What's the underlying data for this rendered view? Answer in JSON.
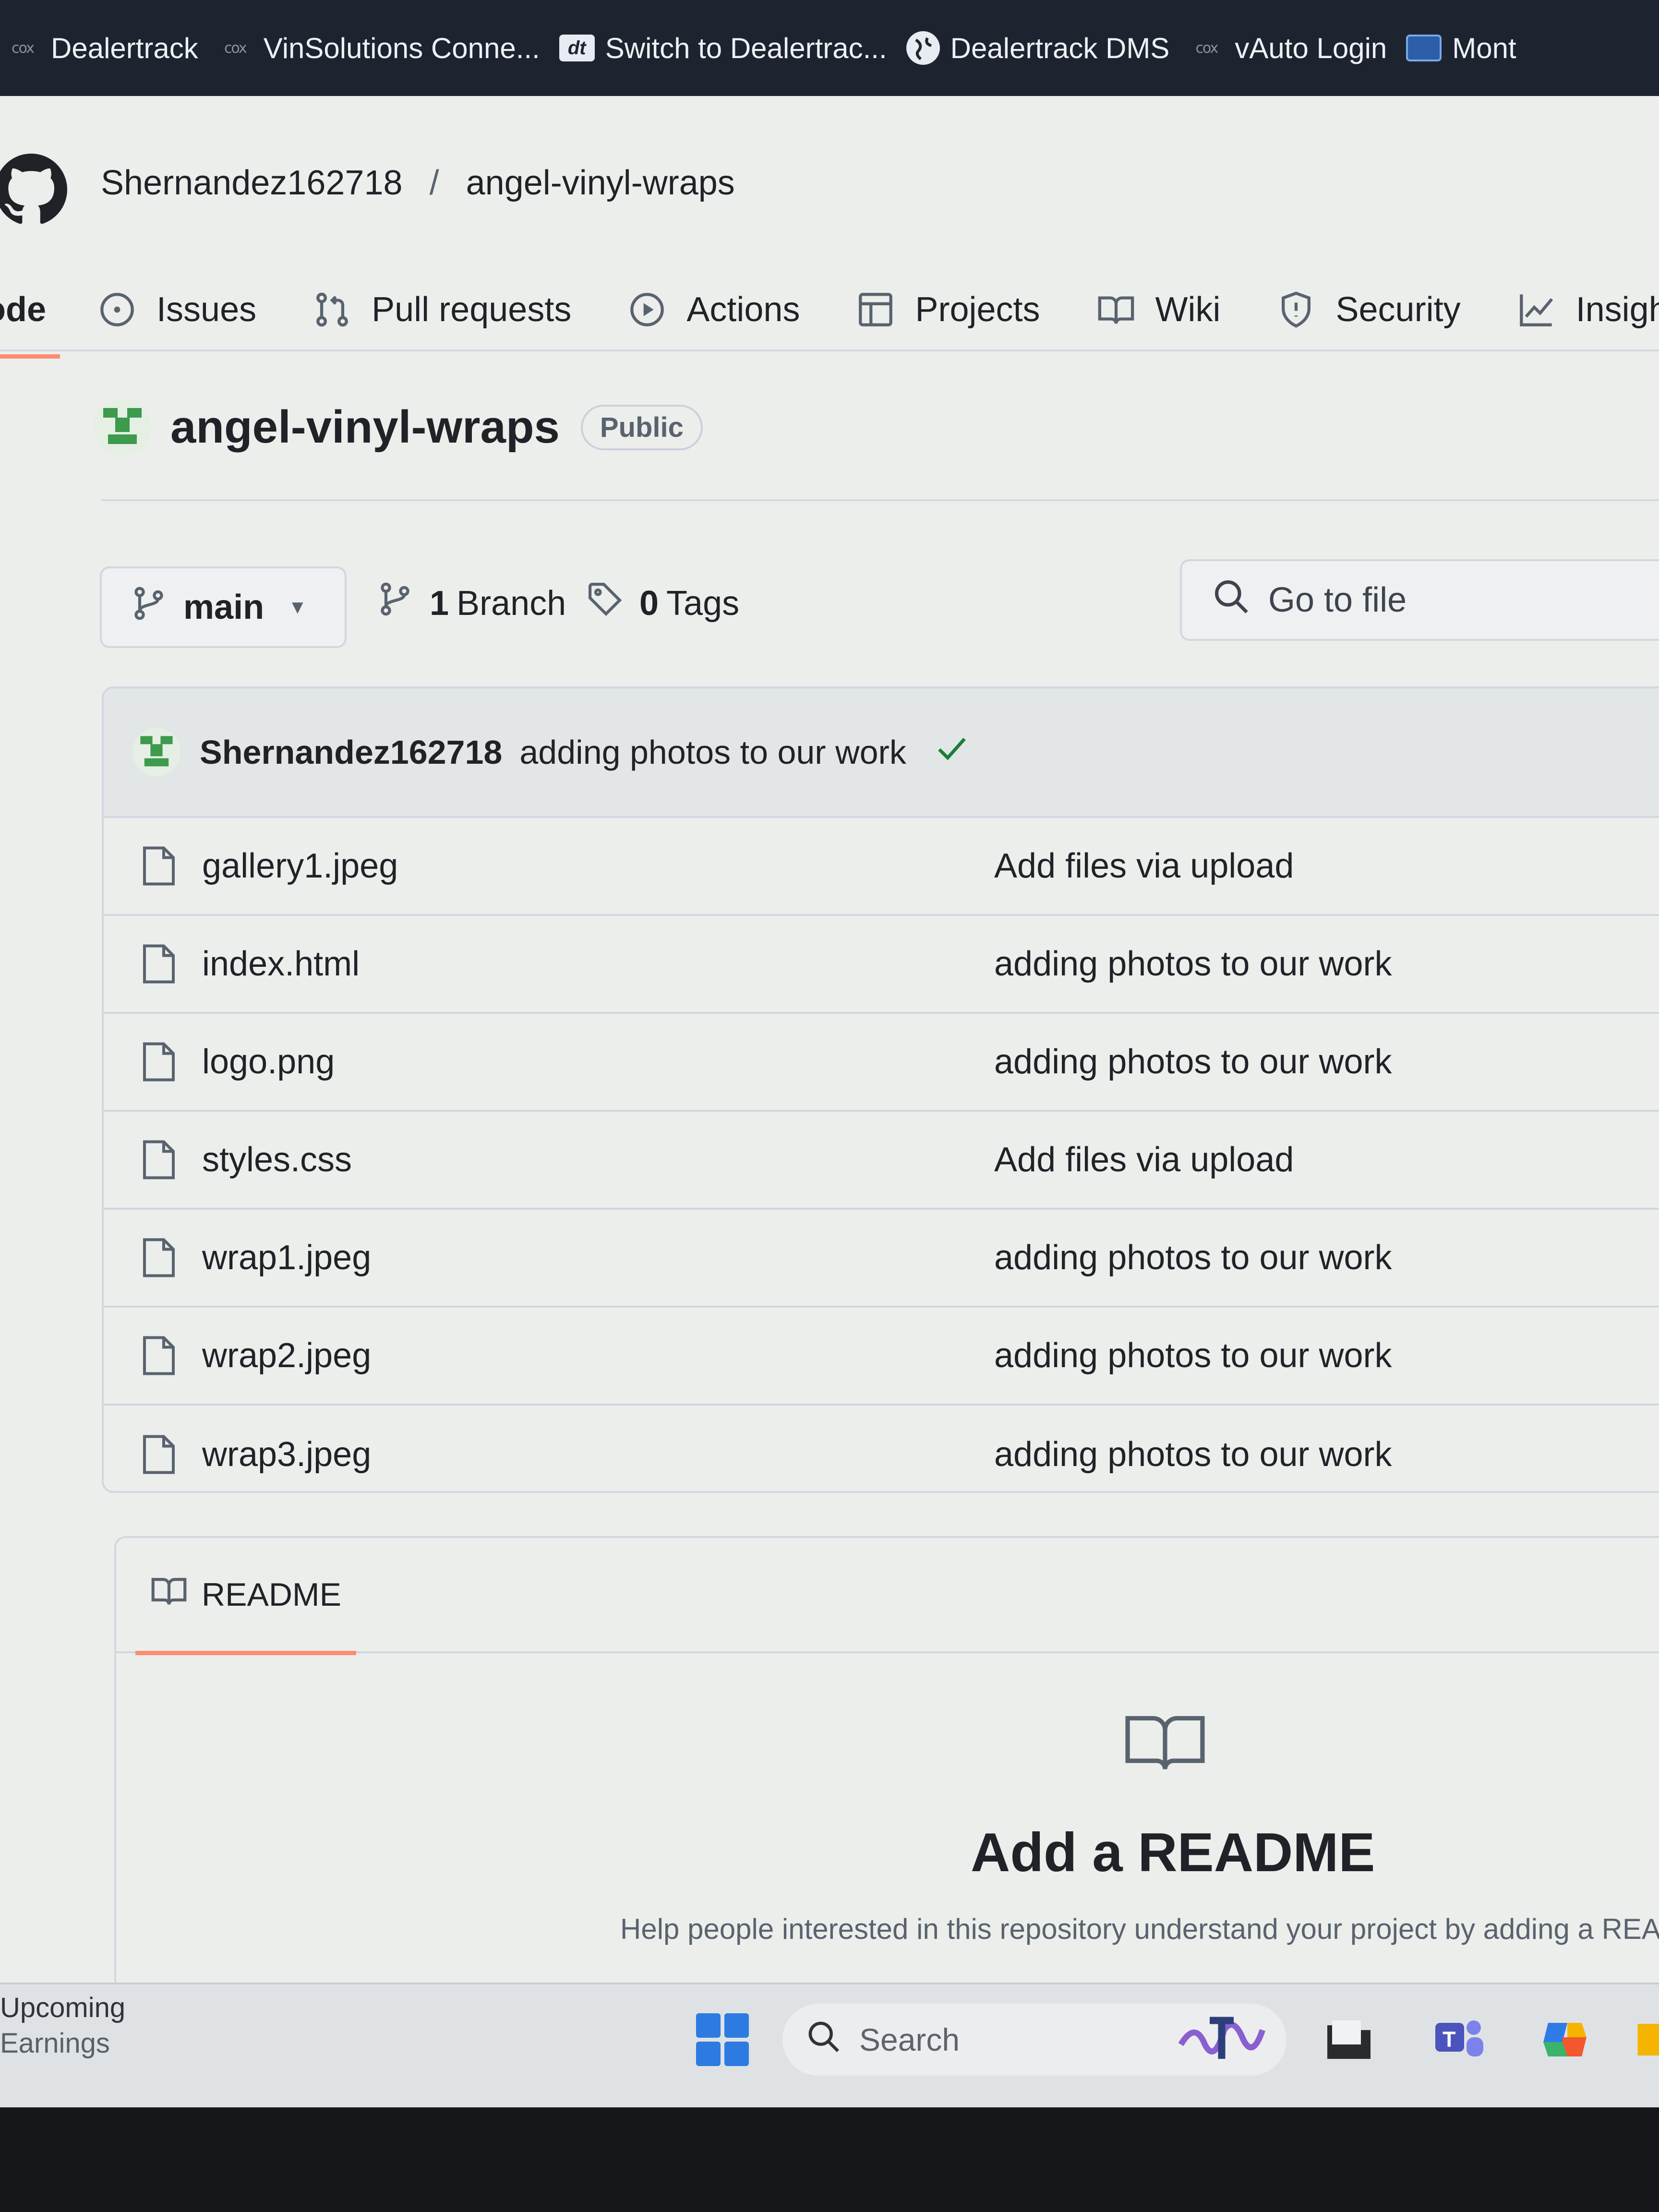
{
  "bookmarks": [
    {
      "icon": "cox-icon",
      "label": "Dealertrack"
    },
    {
      "icon": "cox-icon",
      "label": "VinSolutions Conne..."
    },
    {
      "icon": "dealertrack-icon",
      "label": "Switch to Dealertrac..."
    },
    {
      "icon": "globe-icon",
      "label": "Dealertrack DMS"
    },
    {
      "icon": "cox-icon",
      "label": "vAuto Login"
    },
    {
      "icon": "monitor-icon",
      "label": "Mont"
    }
  ],
  "bookmark_icon_text": {
    "cox": "cox",
    "dealertrack": "dt"
  },
  "repo": {
    "owner": "Shernandez162718",
    "separator": "/",
    "name": "angel-vinyl-wraps",
    "title": "angel-vinyl-wraps",
    "visibility": "Public"
  },
  "tabs": [
    {
      "label": "ode"
    },
    {
      "label": "Issues"
    },
    {
      "label": "Pull requests"
    },
    {
      "label": "Actions"
    },
    {
      "label": "Projects"
    },
    {
      "label": "Wiki"
    },
    {
      "label": "Security"
    },
    {
      "label": "Insigh"
    }
  ],
  "branch": {
    "current": "main",
    "branch_count_num": "1",
    "branch_count_label": "Branch",
    "tag_count_num": "0",
    "tag_count_label": "Tags"
  },
  "goto_file": {
    "placeholder": "Go to file"
  },
  "latest_commit": {
    "author": "Shernandez162718",
    "message": "adding photos to our work",
    "status": "success"
  },
  "files": [
    {
      "name": "gallery1.jpeg",
      "message": "Add files via upload"
    },
    {
      "name": "index.html",
      "message": "adding photos to our work"
    },
    {
      "name": "logo.png",
      "message": "adding photos to our work"
    },
    {
      "name": "styles.css",
      "message": "Add files via upload"
    },
    {
      "name": "wrap1.jpeg",
      "message": "adding photos to our work"
    },
    {
      "name": "wrap2.jpeg",
      "message": "adding photos to our work"
    },
    {
      "name": "wrap3.jpeg",
      "message": "adding photos to our work"
    }
  ],
  "readme": {
    "tab_label": "README",
    "heading": "Add a README",
    "help": "Help people interested in this repository understand your project by adding a READ"
  },
  "taskbar": {
    "widget_line1": "Upcoming",
    "widget_line2": "Earnings",
    "search_label": "Search"
  },
  "colors": {
    "tab_underline": "#fd8c73",
    "success_check": "#1a7f37",
    "avatar_green": "#3e9a4c",
    "start_blue": "#2d7be0"
  }
}
